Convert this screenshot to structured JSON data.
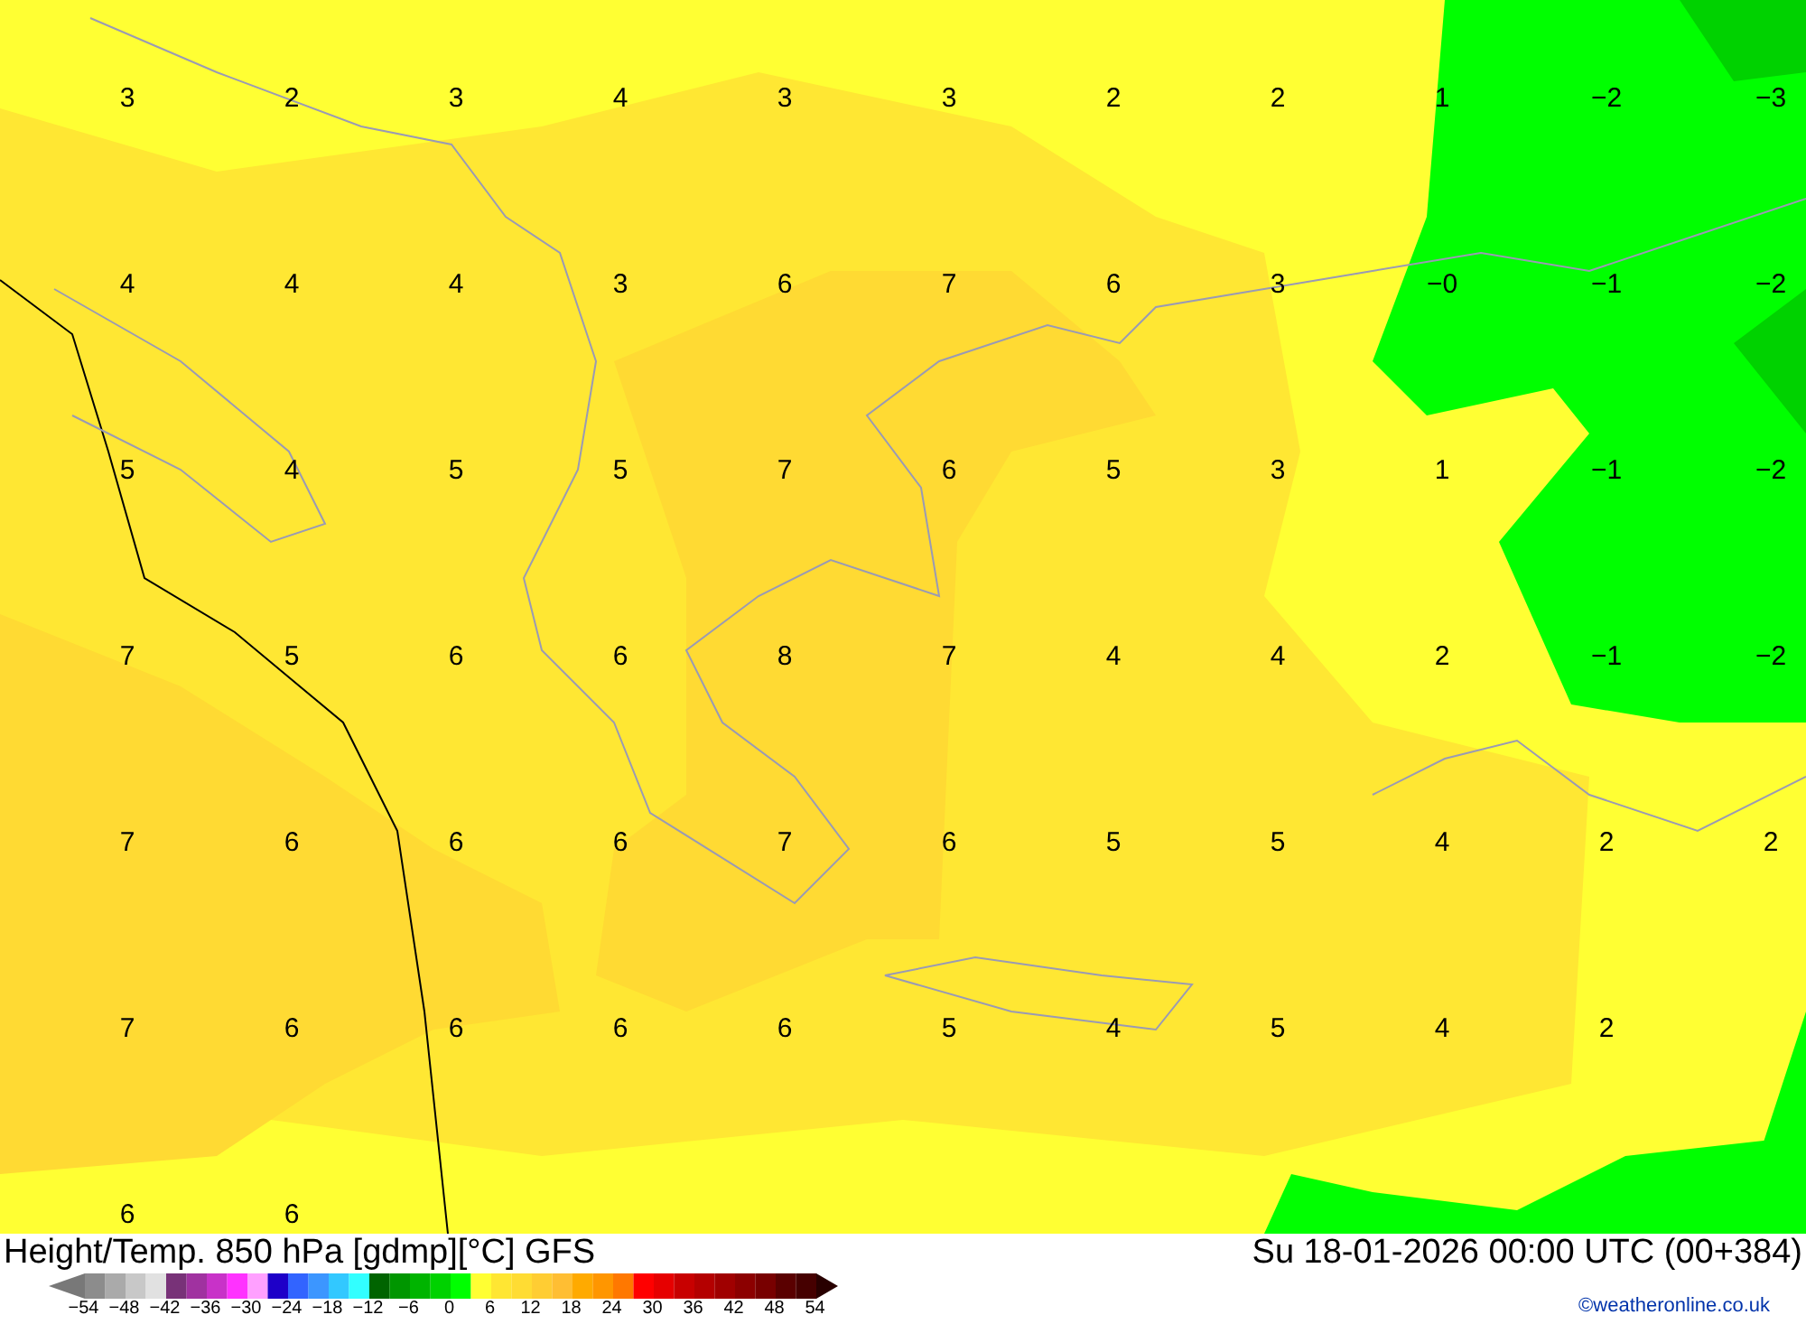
{
  "map": {
    "grid": [
      [
        "3",
        "2",
        "3",
        "4",
        "3",
        "3",
        "2",
        "2",
        "1",
        "−2",
        "−3"
      ],
      [
        "4",
        "4",
        "4",
        "3",
        "6",
        "7",
        "6",
        "3",
        "−0",
        "−1",
        "−2"
      ],
      [
        "5",
        "4",
        "5",
        "5",
        "7",
        "6",
        "5",
        "3",
        "1",
        "−1",
        "−2"
      ],
      [
        "7",
        "5",
        "6",
        "6",
        "8",
        "7",
        "4",
        "4",
        "2",
        "−1",
        "−2"
      ],
      [
        "7",
        "6",
        "6",
        "6",
        "7",
        "6",
        "5",
        "5",
        "4",
        "2",
        "2"
      ],
      [
        "7",
        "6",
        "6",
        "6",
        "6",
        "5",
        "4",
        "5",
        "4",
        "2"
      ],
      [
        "6",
        "6"
      ]
    ]
  },
  "title": "Height/Temp. 850 hPa [gdmp][°C] GFS",
  "date": "Su 18-01-2026 00:00 UTC (00+384)",
  "legend": {
    "ticks": [
      "−54",
      "−48",
      "−42",
      "−36",
      "−30",
      "−24",
      "−18",
      "−12",
      "−6",
      "0",
      "6",
      "12",
      "18",
      "24",
      "30",
      "36",
      "42",
      "48",
      "54"
    ]
  },
  "credit": "©weatheronline.co.uk"
}
